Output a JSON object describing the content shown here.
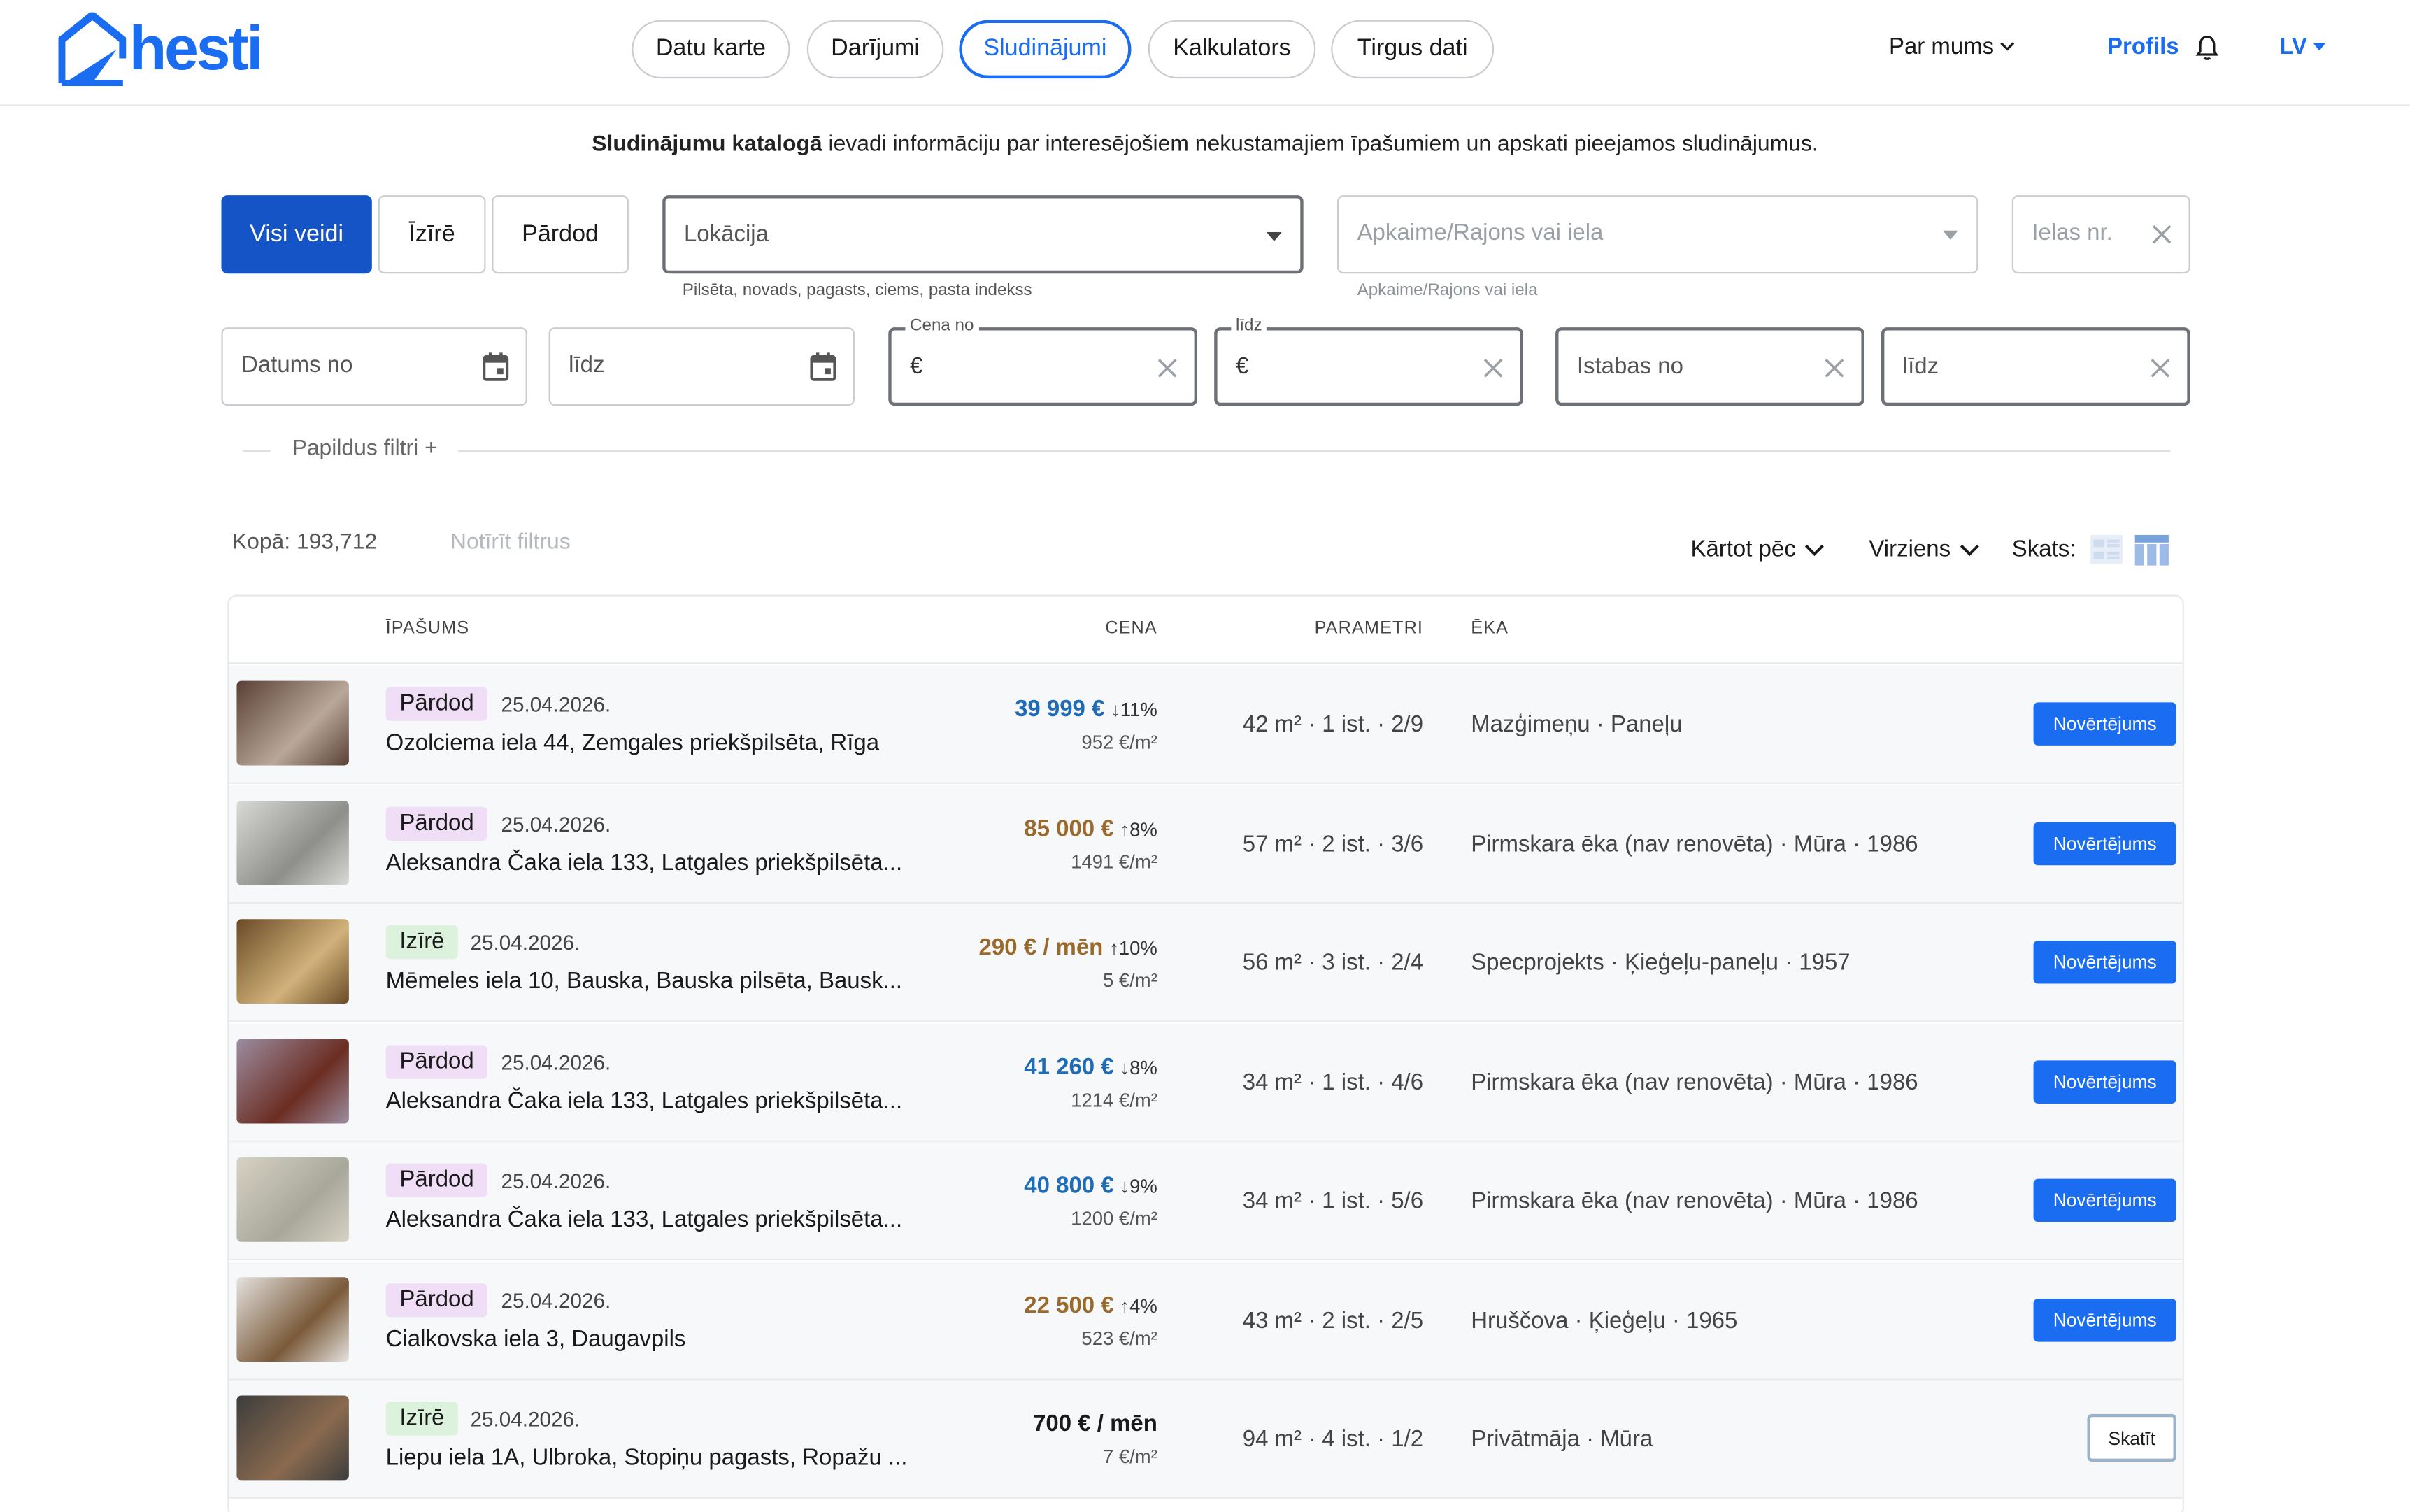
{
  "header": {
    "logo_text": "hesti",
    "nav": [
      {
        "label": "Datu karte",
        "active": false
      },
      {
        "label": "Darījumi",
        "active": false
      },
      {
        "label": "Sludinājumi",
        "active": true
      },
      {
        "label": "Kalkulators",
        "active": false
      },
      {
        "label": "Tirgus dati",
        "active": false
      }
    ],
    "about": "Par mums",
    "profile": "Profils",
    "language": "LV"
  },
  "intro": {
    "bold": "Sludinājumu katalogā",
    "rest": " ievadi informāciju par interesējošiem nekustamajiem īpašumiem un apskati pieejamos sludinājumus."
  },
  "filters": {
    "types": [
      "Visi veidi",
      "Īzīrē",
      "Pārdod"
    ],
    "active_type": "Visi veidi",
    "location_placeholder": "Lokācija",
    "location_helper": "Pilsēta, novads, pagasts, ciems, pasta indekss",
    "district_placeholder": "Apkaime/Rajons vai iela",
    "district_helper": "Apkaime/Rajons vai iela",
    "street_nr_placeholder": "Ielas nr.",
    "date_from_placeholder": "Datums no",
    "date_to_placeholder": "līdz",
    "price_from_label": "Cena no",
    "price_to_label": "līdz",
    "currency": "€",
    "rooms_from_placeholder": "Istabas no",
    "rooms_to_placeholder": "līdz",
    "more_filters": "Papildus filtri +"
  },
  "results": {
    "total": "Kopā: 193,712",
    "clear_filters": "Notīrīt filtrus",
    "sort_by": "Kārtot pēc",
    "direction": "Virziens",
    "view_label": "Skats:"
  },
  "table": {
    "columns": [
      "ĪPAŠUMS",
      "CENA",
      "PARAMETRI",
      "ĒKA"
    ],
    "rows": [
      {
        "type": "Pārdod",
        "kind": "sell",
        "date": "25.04.2026.",
        "address": "Ozolciema iela 44, Zemgales priekšpilsēta, Rīga",
        "price": "39 999 €",
        "change": "↓11%",
        "price_color": "blue",
        "ppm": "952 €/m²",
        "params": "42 m² · 1 ist. · 2/9",
        "building": "Mazģimeņu · Paneļu",
        "action": "Novērtējums",
        "action_style": "primary",
        "thumb": [
          "#5a4034",
          "#b8a79a"
        ]
      },
      {
        "type": "Pārdod",
        "kind": "sell",
        "date": "25.04.2026.",
        "address": "Aleksandra Čaka iela 133, Latgales priekšpilsēta...",
        "price": "85 000 €",
        "change": "↑8%",
        "price_color": "brown",
        "ppm": "1491 €/m²",
        "params": "57 m² · 2 ist. · 3/6",
        "building": "Pirmskara ēka (nav renovēta) · Mūra · 1986",
        "action": "Novērtējums",
        "action_style": "primary",
        "thumb": [
          "#d9d9d6",
          "#8e8f8a"
        ]
      },
      {
        "type": "Izīrē",
        "kind": "rent",
        "date": "25.04.2026.",
        "address": "Mēmeles iela 10, Bauska, Bauska pilsēta, Bausk...",
        "price": "290 € / mēn",
        "change": "↑10%",
        "price_color": "brown",
        "ppm": "5 €/m²",
        "params": "56 m² · 3 ist. · 2/4",
        "building": "Specprojekts · Ķieģeļu-paneļu · 1957",
        "action": "Novērtējums",
        "action_style": "primary",
        "thumb": [
          "#6a4a26",
          "#d1b27a"
        ]
      },
      {
        "type": "Pārdod",
        "kind": "sell",
        "date": "25.04.2026.",
        "address": "Aleksandra Čaka iela 133, Latgales priekšpilsēta...",
        "price": "41 260 €",
        "change": "↓8%",
        "price_color": "blue",
        "ppm": "1214 €/m²",
        "params": "34 m² · 1 ist. · 4/6",
        "building": "Pirmskara ēka (nav renovēta) · Mūra · 1986",
        "action": "Novērtējums",
        "action_style": "primary",
        "thumb": [
          "#9c8da0",
          "#6b2d22"
        ]
      },
      {
        "type": "Pārdod",
        "kind": "sell",
        "date": "25.04.2026.",
        "address": "Aleksandra Čaka iela 133, Latgales priekšpilsēta...",
        "price": "40 800 €",
        "change": "↓9%",
        "price_color": "blue",
        "ppm": "1200 €/m²",
        "params": "34 m² · 1 ist. · 5/6",
        "building": "Pirmskara ēka (nav renovēta) · Mūra · 1986",
        "action": "Novērtējums",
        "action_style": "primary",
        "thumb": [
          "#d6d2c4",
          "#a8a89a"
        ]
      },
      {
        "type": "Pārdod",
        "kind": "sell",
        "date": "25.04.2026.",
        "address": "Cialkovska iela 3, Daugavpils",
        "price": "22 500 €",
        "change": "↑4%",
        "price_color": "brown",
        "ppm": "523 €/m²",
        "params": "43 m² · 2 ist. · 2/5",
        "building": "Hruščova · Ķieģeļu · 1965",
        "action": "Novērtējums",
        "action_style": "primary",
        "thumb": [
          "#e4e2de",
          "#7a5a3a"
        ]
      },
      {
        "type": "Izīrē",
        "kind": "rent",
        "date": "25.04.2026.",
        "address": "Liepu iela 1A, Ulbroka, Stopiņu pagasts, Ropažu ...",
        "price": "700 € / mēn",
        "change": "",
        "price_color": "black",
        "ppm": "7 €/m²",
        "params": "94 m² · 4 ist. · 1/2",
        "building": "Privātmāja · Mūra",
        "action": "Skatīt",
        "action_style": "outline",
        "thumb": [
          "#3d3d3d",
          "#8a6a4e"
        ]
      }
    ]
  },
  "colors": {
    "brand": "#1a6cf0",
    "active_type_bg": "#1554c7",
    "sell_badge": "#f0def7",
    "rent_badge": "#dcf2dd",
    "price_down": "#1f6bb5",
    "price_up": "#9a6a2c"
  },
  "icons": [
    "hesti-logo-icon",
    "chevron-down-icon",
    "bell-icon",
    "caret-down-icon",
    "calendar-icon",
    "close-icon",
    "list-view-icon",
    "table-view-icon"
  ]
}
